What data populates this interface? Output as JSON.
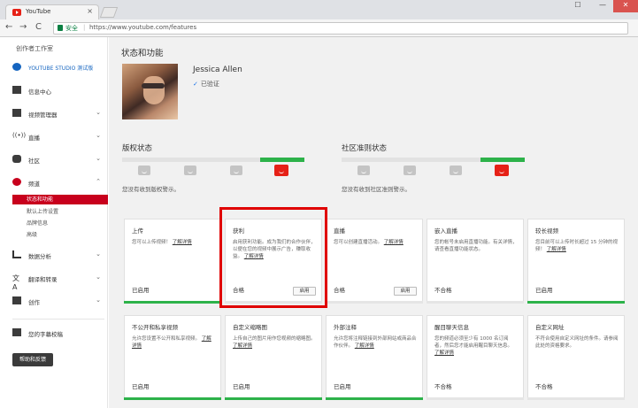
{
  "browser": {
    "tab_title": "YouTube",
    "tab_close": "×",
    "security_label": "安全",
    "url": "https://www.youtube.com/features",
    "back": "←",
    "forward": "→",
    "reload": "C",
    "win_user": "☐",
    "win_min": "—",
    "win_close": "✕"
  },
  "sidebar": {
    "heading": "创作者工作室",
    "items": [
      {
        "label": "YOUTUBE STUDIO 测试版",
        "icon": "gear-icon"
      },
      {
        "label": "信息中心",
        "icon": "dashboard-icon"
      },
      {
        "label": "视频管理器",
        "icon": "video-manager-icon"
      },
      {
        "label": "直播",
        "icon": "live-icon"
      },
      {
        "label": "社区",
        "icon": "community-icon"
      },
      {
        "label": "频道",
        "icon": "channel-icon"
      },
      {
        "label": "数据分析",
        "icon": "analytics-icon"
      },
      {
        "label": "翻译和转录",
        "icon": "translate-icon"
      },
      {
        "label": "创作",
        "icon": "create-icon"
      },
      {
        "label": "您的字幕校稿",
        "icon": "subtitles-icon"
      }
    ],
    "sub_items": [
      "状态和功能",
      "默认上传设置",
      "品牌信息",
      "高级"
    ],
    "feedback_button": "帮助和反馈"
  },
  "main": {
    "page_title": "状态和功能",
    "channel_name": "Jessica Allen",
    "verified_label": "已验证",
    "copyright_title": "版权状态",
    "copyright_msg": "您没有收到版权警示。",
    "community_title": "社区准则状态",
    "community_msg": "您没有收到社区准则警示。",
    "cards_row1": [
      {
        "title": "上传",
        "desc": "您可以上传视频！",
        "link": "了解详情",
        "status": "已启用",
        "button": "",
        "enabled": true
      },
      {
        "title": "获利",
        "desc": "启用获利功能。成为我们的合作伙伴，以便在您的视频中展示广告，赚取收益。",
        "link": "了解详情",
        "status": "合格",
        "button": "启用",
        "enabled": false
      },
      {
        "title": "直播",
        "desc": "您可以创建直播活动。",
        "link": "了解详情",
        "status": "合格",
        "button": "启用",
        "enabled": false
      },
      {
        "title": "嵌入直播",
        "desc": "您的帐号未启用直播功能。有关详情，请查看直播功能状态。",
        "link": "",
        "status": "不合格",
        "button": "",
        "enabled": false
      },
      {
        "title": "较长视频",
        "desc": "您目前可以上传时长超过 15 分钟的视频！",
        "link": "了解详情",
        "status": "已启用",
        "button": "",
        "enabled": true
      }
    ],
    "cards_row2": [
      {
        "title": "不公开和私享视频",
        "desc": "允许您设置不公开和私享视频。",
        "link": "了解详情",
        "status": "已启用",
        "button": "",
        "enabled": true
      },
      {
        "title": "自定义缩略图",
        "desc": "上传自己的图片用作您视频的缩略图。",
        "link": "了解详情",
        "status": "已启用",
        "button": "",
        "enabled": true
      },
      {
        "title": "外部注释",
        "desc": "允许您将注释链接到外部网站或商品合作伙伴。",
        "link": "了解详情",
        "status": "已启用",
        "button": "",
        "enabled": true
      },
      {
        "title": "醒目聊天信息",
        "desc": "您的频道必须至少有 1000 名订阅者，然后您才能启用醒目聊天信息。",
        "link": "了解详情",
        "status": "不合格",
        "button": "",
        "enabled": false
      },
      {
        "title": "自定义网址",
        "desc": "不符合使用自定义网址的条件。请参阅此处的资格要求。",
        "link": "",
        "status": "不合格",
        "button": "",
        "enabled": false
      }
    ]
  }
}
